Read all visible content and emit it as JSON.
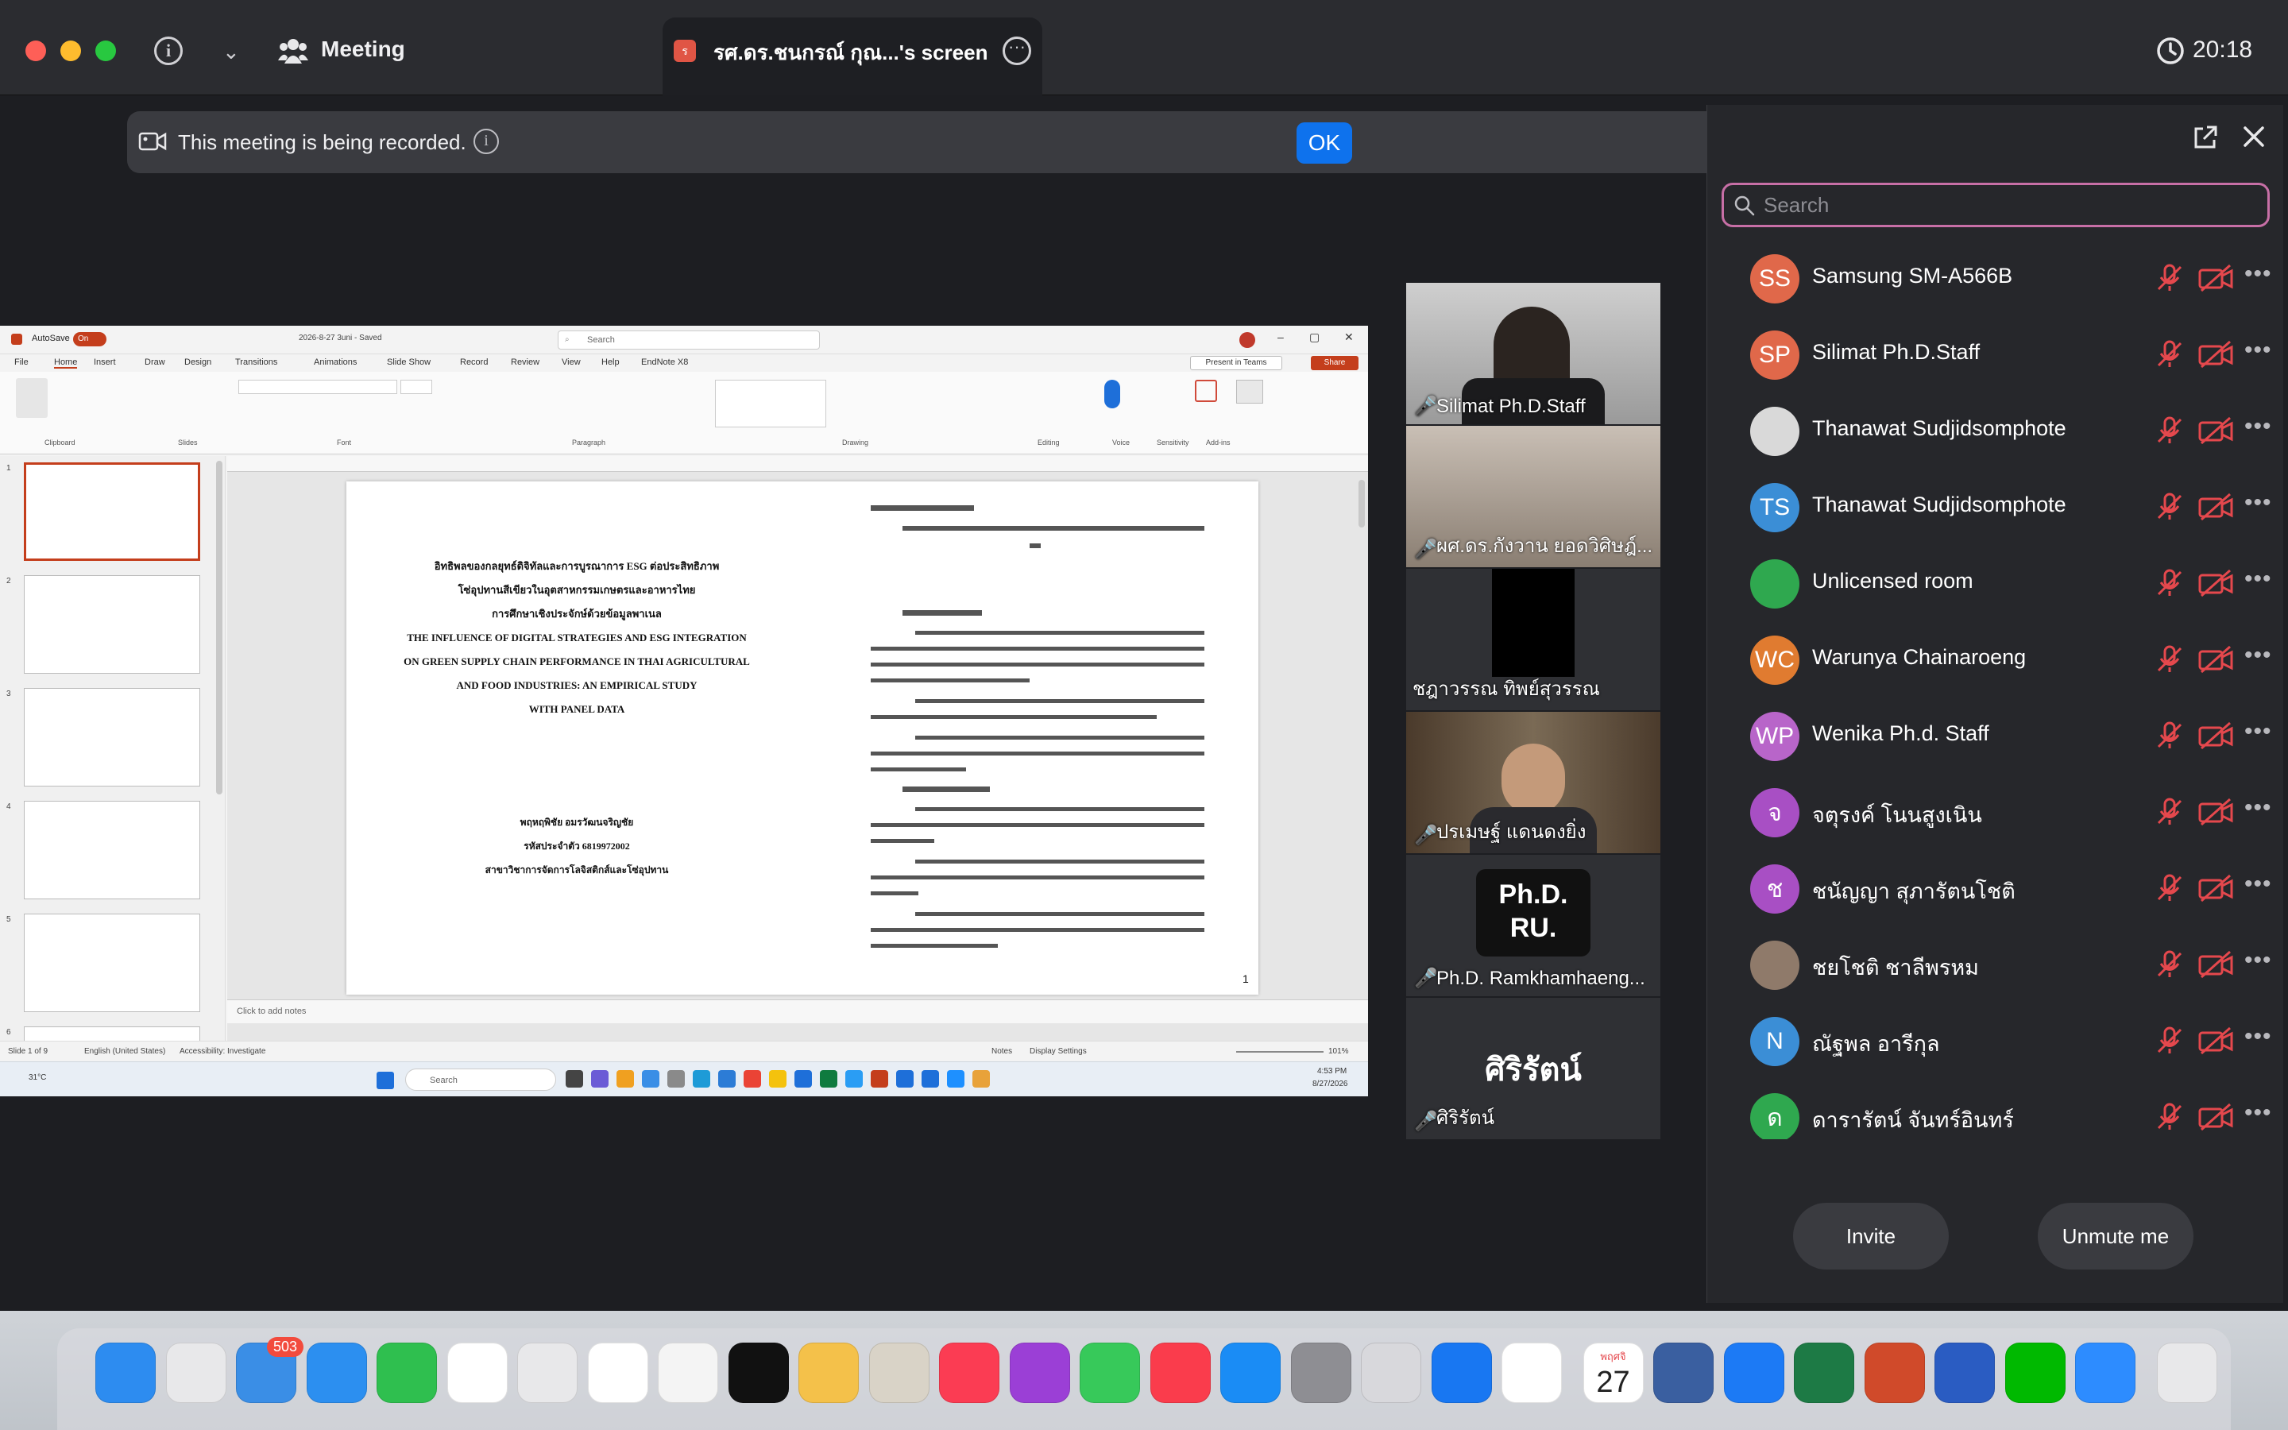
{
  "titlebar": {
    "meeting_label": "Meeting",
    "share_tab_title": "รศ.ดร.ชนกรณ์ กุณ...'s screen",
    "clock": "20:18"
  },
  "recording": {
    "message": "This meeting is being recorded.",
    "ok_label": "OK"
  },
  "panel": {
    "search_placeholder": "Search",
    "invite_label": "Invite",
    "unmute_label": "Unmute me",
    "participants": [
      {
        "initials": "SS",
        "name": "Samsung SM-A566B",
        "color": "#e0684a"
      },
      {
        "initials": "SP",
        "name": "Silimat Ph.D.Staff",
        "color": "#e0684a"
      },
      {
        "initials": "",
        "name": "Thanawat Sudjidsomphote",
        "color": "#d9d9d9"
      },
      {
        "initials": "TS",
        "name": "Thanawat Sudjidsomphote",
        "color": "#3b8ed6"
      },
      {
        "initials": "",
        "name": "Unlicensed room",
        "color": "#2fa84f"
      },
      {
        "initials": "WC",
        "name": "Warunya Chainaroeng",
        "color": "#e07b30"
      },
      {
        "initials": "WP",
        "name": "Wenika Ph.d. Staff",
        "color": "#b865c9"
      },
      {
        "initials": "จ",
        "name": "จตุรงค์ โนนสูงเนิน",
        "color": "#a84fc4"
      },
      {
        "initials": "ช",
        "name": "ชนัญญา สุภารัตนโชติ",
        "color": "#a84fc4"
      },
      {
        "initials": "",
        "name": "ชยโชติ ชาลีพรหม",
        "color": "#8f7a6a"
      },
      {
        "initials": "N",
        "name": "ณัฐพล อารีกุล",
        "color": "#3b8ed6"
      },
      {
        "initials": "ด",
        "name": "ดารารัตน์ จันทร์อินทร์",
        "color": "#2fa84f"
      }
    ]
  },
  "tiles": {
    "t1": "Silimat Ph.D.Staff",
    "t2": "ผศ.ดร.กังวาน ยอดวิศิษฎ์...",
    "t3": "ชฎาวรรณ ทิพย์สุวรรณ",
    "t4": "ปรเมษฐ์ แดนดงยิ่ง",
    "t5": "Ph.D. Ramkhamhaeng...",
    "t5_logo_1": "Ph.D.",
    "t5_logo_2": "RU.",
    "t6": "ศิริรัตน์",
    "t6_big": "ศิริรัตน์"
  },
  "ppt": {
    "autosave": "AutoSave",
    "autosave_state": "On",
    "filename": "2026-8-27 3uni - Saved",
    "search": "Search",
    "menu": [
      "File",
      "Home",
      "Insert",
      "Draw",
      "Design",
      "Transitions",
      "Animations",
      "Slide Show",
      "Record",
      "Review",
      "View",
      "Help",
      "EndNote X8"
    ],
    "present_teams": "Present in Teams",
    "share": "Share",
    "groups": [
      "Clipboard",
      "Slides",
      "Font",
      "Paragraph",
      "Drawing",
      "Editing",
      "Voice",
      "Sensitivity",
      "Add-ins"
    ],
    "slide_title_th_1": "อิทธิพลของกลยุทธ์ดิจิทัลและการบูรณาการ ESG ต่อประสิทธิภาพ",
    "slide_title_th_2": "โซ่อุปทานสีเขียวในอุตสาหกรรมเกษตรและอาหารไทย",
    "slide_title_th_3": "การศึกษาเชิงประจักษ์ด้วยข้อมูลพาเนล",
    "slide_title_en_1": "THE INFLUENCE OF DIGITAL STRATEGIES AND ESG INTEGRATION",
    "slide_title_en_2": "ON GREEN SUPPLY CHAIN PERFORMANCE IN THAI AGRICULTURAL",
    "slide_title_en_3": "AND FOOD INDUSTRIES: AN EMPIRICAL STUDY",
    "slide_title_en_4": "WITH PANEL DATA",
    "author_1": "พฤหฤพิชัย อมรวัฒนจริญชัย",
    "author_2": "รหัสประจำตัว 6819972002",
    "author_3": "สาขาวิชาการจัดการโลจิสติกส์และโซ่อุปทาน",
    "page_number": "1",
    "notes": "Click to add notes",
    "status_left": "Slide 1 of 9",
    "status_lang": "English (United States)",
    "status_access": "Accessibility: Investigate",
    "status_notes": "Notes",
    "status_display": "Display Settings",
    "zoom": "101%",
    "taskbar_search": "Search",
    "taskbar_time": "4:53 PM",
    "taskbar_date": "8/27/2026",
    "weather": "31°C",
    "thumbs": [
      "1",
      "2",
      "3",
      "4",
      "5",
      "6"
    ]
  },
  "dock": {
    "mail_badge": "503",
    "cal_month": "พฤศจิ",
    "cal_day": "27",
    "apps": [
      "finder",
      "launchpad",
      "mail",
      "safari",
      "facetime",
      "chrome",
      "maps",
      "reminders",
      "photos",
      "appletv",
      "notes",
      "contacts",
      "music",
      "podcasts",
      "messages",
      "news",
      "appstore",
      "settings",
      "iphone-mirroring",
      "facebook",
      "gmail",
      "calendar",
      "disk",
      "quickshare",
      "excel",
      "powerpoint",
      "word",
      "line",
      "zoom",
      "trash"
    ]
  }
}
